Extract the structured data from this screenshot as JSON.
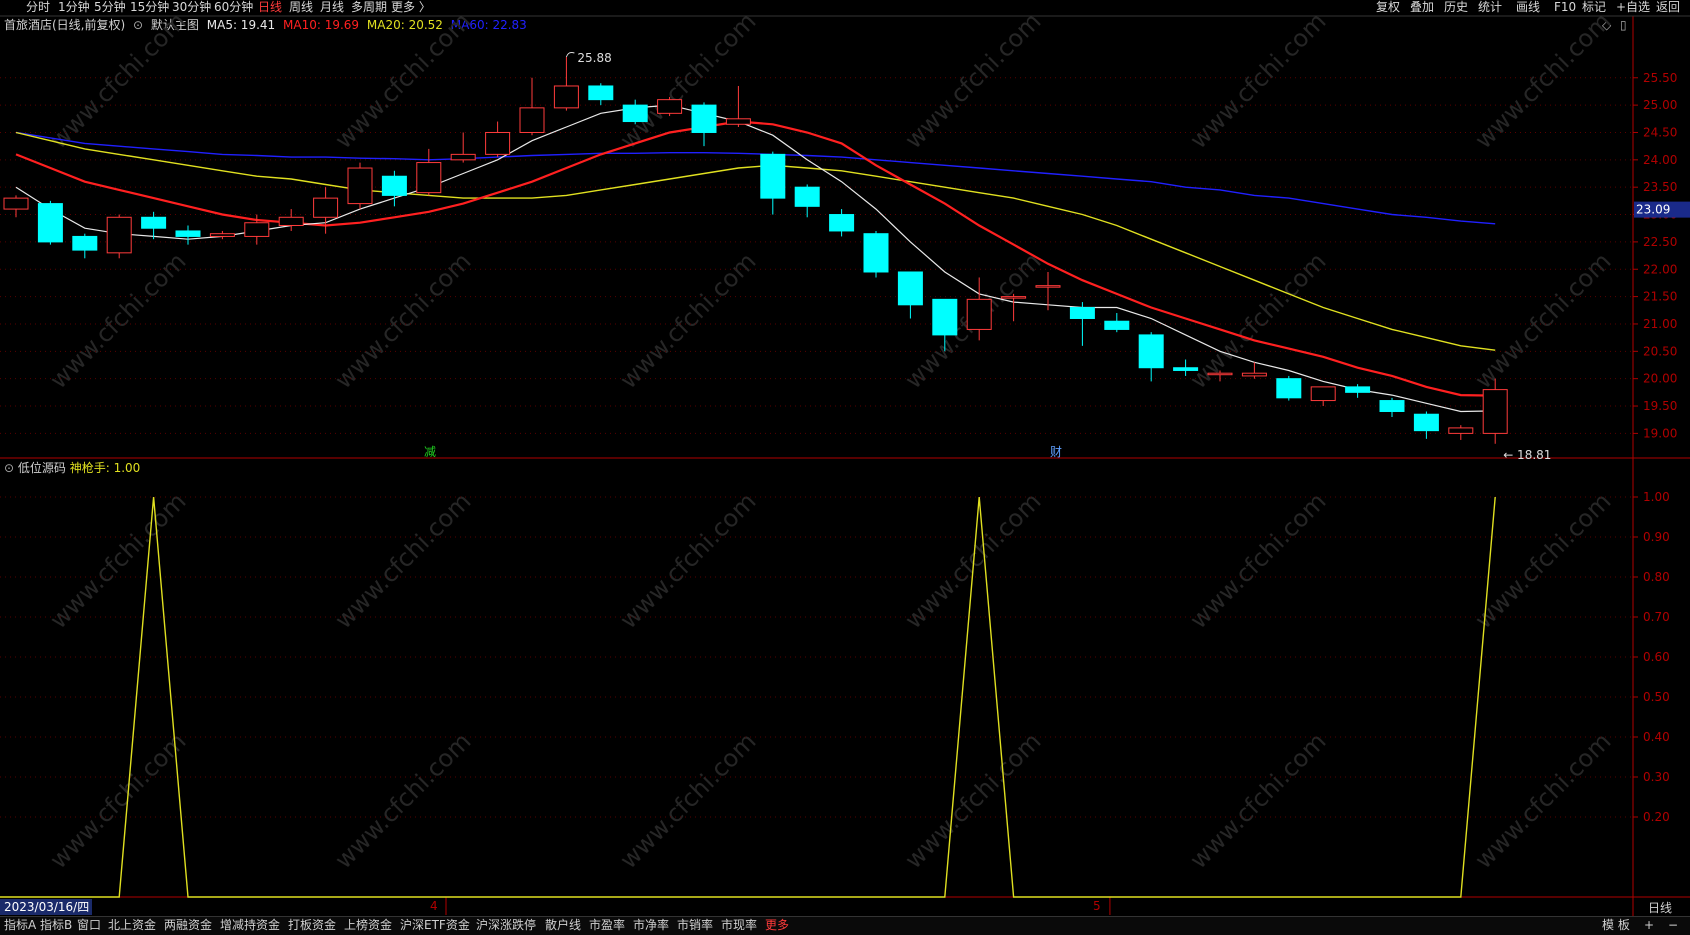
{
  "colors": {
    "up": "#ff3b3b",
    "down": "#00ffff",
    "ma5": "#e8e8e8",
    "ma10": "#ff2020",
    "ma20": "#e0e020",
    "ma60": "#2020ff",
    "indicator": "#e0e020",
    "axis": "#b00000",
    "grid": "#5a0000"
  },
  "topbar": {
    "periods": [
      "分时",
      "1分钟",
      "5分钟",
      "15分钟",
      "30分钟",
      "60分钟",
      "日线",
      "周线",
      "月线",
      "多周期",
      "更多 〉"
    ],
    "active_period": "日线",
    "right_buttons": [
      "复权",
      "叠加",
      "历史",
      "统计",
      "画线",
      "F10",
      "+自选",
      "返回"
    ],
    "mark_label": "标记"
  },
  "main_chart": {
    "stock_name": "首旅酒店(日线,前复权)",
    "main_chart_label": "默认主图",
    "ma5_label": "MA5: 19.41",
    "ma10_label": "MA10: 19.69",
    "ma20_label": "MA20: 20.52",
    "ma60_label": "MA60: 22.83",
    "high_label": "25.88",
    "low_label": "18.81",
    "current_price": "23.09",
    "marker_jian": "减",
    "marker_cai": "财",
    "y_ticks": [
      "25.50",
      "25.00",
      "24.50",
      "24.00",
      "23.50",
      "23.00",
      "22.50",
      "22.00",
      "21.50",
      "21.00",
      "20.50",
      "20.00",
      "19.50",
      "19.00"
    ]
  },
  "chart_data": [
    {
      "type": "candlestick",
      "title": "首旅酒店(日线,前复权)",
      "ylim": [
        18.55,
        26.3
      ],
      "candles": [
        {
          "o": 23.1,
          "h": 23.35,
          "l": 22.95,
          "c": 23.3
        },
        {
          "o": 23.2,
          "h": 23.25,
          "l": 22.45,
          "c": 22.5
        },
        {
          "o": 22.6,
          "h": 22.65,
          "l": 22.2,
          "c": 22.35
        },
        {
          "o": 22.3,
          "h": 23.0,
          "l": 22.2,
          "c": 22.95
        },
        {
          "o": 22.95,
          "h": 23.05,
          "l": 22.55,
          "c": 22.75
        },
        {
          "o": 22.7,
          "h": 22.8,
          "l": 22.45,
          "c": 22.6
        },
        {
          "o": 22.6,
          "h": 22.7,
          "l": 22.55,
          "c": 22.65
        },
        {
          "o": 22.6,
          "h": 23.0,
          "l": 22.45,
          "c": 22.85
        },
        {
          "o": 22.8,
          "h": 23.1,
          "l": 22.7,
          "c": 22.95
        },
        {
          "o": 22.95,
          "h": 23.5,
          "l": 22.65,
          "c": 23.3
        },
        {
          "o": 23.2,
          "h": 23.95,
          "l": 23.1,
          "c": 23.85
        },
        {
          "o": 23.7,
          "h": 23.8,
          "l": 23.15,
          "c": 23.35
        },
        {
          "o": 23.4,
          "h": 24.2,
          "l": 23.35,
          "c": 23.95
        },
        {
          "o": 24.0,
          "h": 24.5,
          "l": 23.95,
          "c": 24.1
        },
        {
          "o": 24.1,
          "h": 24.7,
          "l": 24.05,
          "c": 24.5
        },
        {
          "o": 24.5,
          "h": 25.5,
          "l": 24.45,
          "c": 24.95
        },
        {
          "o": 24.95,
          "h": 25.88,
          "l": 24.9,
          "c": 25.35
        },
        {
          "o": 25.35,
          "h": 25.4,
          "l": 25.0,
          "c": 25.1
        },
        {
          "o": 25.0,
          "h": 25.1,
          "l": 24.65,
          "c": 24.7
        },
        {
          "o": 24.85,
          "h": 25.15,
          "l": 24.8,
          "c": 25.1
        },
        {
          "o": 25.0,
          "h": 25.05,
          "l": 24.25,
          "c": 24.5
        },
        {
          "o": 24.65,
          "h": 25.35,
          "l": 24.6,
          "c": 24.75
        },
        {
          "o": 24.1,
          "h": 24.15,
          "l": 23.0,
          "c": 23.3
        },
        {
          "o": 23.5,
          "h": 23.55,
          "l": 22.95,
          "c": 23.15
        },
        {
          "o": 23.0,
          "h": 23.1,
          "l": 22.6,
          "c": 22.7
        },
        {
          "o": 22.65,
          "h": 22.7,
          "l": 21.85,
          "c": 21.95
        },
        {
          "o": 21.95,
          "h": 21.95,
          "l": 21.1,
          "c": 21.35
        },
        {
          "o": 21.45,
          "h": 21.45,
          "l": 20.5,
          "c": 20.8
        },
        {
          "o": 20.9,
          "h": 21.85,
          "l": 20.7,
          "c": 21.45
        },
        {
          "o": 21.5,
          "h": 21.55,
          "l": 21.05,
          "c": 21.5
        },
        {
          "o": 21.7,
          "h": 21.95,
          "l": 21.25,
          "c": 21.7
        },
        {
          "o": 21.3,
          "h": 21.4,
          "l": 20.6,
          "c": 21.1
        },
        {
          "o": 21.05,
          "h": 21.2,
          "l": 20.85,
          "c": 20.9
        },
        {
          "o": 20.8,
          "h": 20.85,
          "l": 19.95,
          "c": 20.2
        },
        {
          "o": 20.2,
          "h": 20.35,
          "l": 20.05,
          "c": 20.15
        },
        {
          "o": 20.1,
          "h": 20.15,
          "l": 19.95,
          "c": 20.1
        },
        {
          "o": 20.05,
          "h": 20.3,
          "l": 20.0,
          "c": 20.1
        },
        {
          "o": 20.0,
          "h": 20.05,
          "l": 19.6,
          "c": 19.65
        },
        {
          "o": 19.6,
          "h": 19.85,
          "l": 19.5,
          "c": 19.85
        },
        {
          "o": 19.85,
          "h": 19.9,
          "l": 19.65,
          "c": 19.75
        },
        {
          "o": 19.6,
          "h": 19.65,
          "l": 19.3,
          "c": 19.4
        },
        {
          "o": 19.35,
          "h": 19.4,
          "l": 18.9,
          "c": 19.05
        },
        {
          "o": 19.0,
          "h": 19.15,
          "l": 18.88,
          "c": 19.1
        },
        {
          "o": 19.0,
          "h": 20.0,
          "l": 18.81,
          "c": 19.8
        }
      ],
      "series": [
        {
          "name": "MA5",
          "values": [
            23.5,
            23.1,
            22.75,
            22.65,
            22.6,
            22.55,
            22.6,
            22.7,
            22.8,
            22.85,
            23.1,
            23.3,
            23.5,
            23.75,
            24.0,
            24.35,
            24.6,
            24.85,
            24.95,
            25.0,
            24.85,
            24.7,
            24.45,
            24.0,
            23.6,
            23.1,
            22.5,
            21.95,
            21.55,
            21.4,
            21.35,
            21.3,
            21.3,
            21.1,
            20.8,
            20.5,
            20.3,
            20.15,
            19.95,
            19.8,
            19.7,
            19.55,
            19.4,
            19.41
          ]
        },
        {
          "name": "MA10",
          "values": [
            24.1,
            23.85,
            23.6,
            23.45,
            23.3,
            23.15,
            23.0,
            22.9,
            22.85,
            22.8,
            22.85,
            22.95,
            23.05,
            23.2,
            23.4,
            23.6,
            23.85,
            24.1,
            24.3,
            24.5,
            24.6,
            24.7,
            24.65,
            24.5,
            24.3,
            23.9,
            23.55,
            23.2,
            22.8,
            22.45,
            22.1,
            21.8,
            21.55,
            21.3,
            21.1,
            20.9,
            20.7,
            20.55,
            20.4,
            20.2,
            20.05,
            19.85,
            19.7,
            19.69
          ]
        },
        {
          "name": "MA20",
          "values": [
            24.5,
            24.35,
            24.2,
            24.1,
            24.0,
            23.9,
            23.8,
            23.7,
            23.65,
            23.55,
            23.45,
            23.4,
            23.35,
            23.3,
            23.3,
            23.3,
            23.35,
            23.45,
            23.55,
            23.65,
            23.75,
            23.85,
            23.9,
            23.85,
            23.8,
            23.7,
            23.6,
            23.5,
            23.4,
            23.3,
            23.15,
            23.0,
            22.8,
            22.55,
            22.3,
            22.05,
            21.8,
            21.55,
            21.3,
            21.1,
            20.9,
            20.75,
            20.6,
            20.52
          ]
        },
        {
          "name": "MA60",
          "values": [
            24.5,
            24.4,
            24.3,
            24.25,
            24.2,
            24.15,
            24.1,
            24.08,
            24.05,
            24.05,
            24.03,
            24.02,
            24.0,
            24.02,
            24.05,
            24.08,
            24.1,
            24.12,
            24.12,
            24.13,
            24.13,
            24.12,
            24.1,
            24.08,
            24.05,
            24.0,
            23.95,
            23.9,
            23.85,
            23.8,
            23.75,
            23.7,
            23.65,
            23.6,
            23.5,
            23.45,
            23.35,
            23.3,
            23.2,
            23.1,
            23.0,
            22.95,
            22.88,
            22.83
          ]
        }
      ]
    },
    {
      "type": "line",
      "title": "低位源码",
      "ylim": [
        0.0,
        1.05
      ],
      "series": [
        {
          "name": "神枪手",
          "values": [
            0,
            0,
            0,
            0,
            1,
            0,
            0,
            0,
            0,
            0,
            0,
            0,
            0,
            0,
            0,
            0,
            0,
            0,
            0,
            0,
            0,
            0,
            0,
            0,
            0,
            0,
            0,
            0,
            1,
            0,
            0,
            0,
            0,
            0,
            0,
            0,
            0,
            0,
            0,
            0,
            0,
            0,
            0,
            1
          ]
        }
      ],
      "y_ticks": [
        "1.00",
        "0.90",
        "0.80",
        "0.70",
        "0.60",
        "0.50",
        "0.40",
        "0.30",
        "0.20"
      ]
    }
  ],
  "indicator": {
    "name": "低位源码",
    "value_label": "神枪手: 1.00"
  },
  "x_axis": {
    "date": "2023/03/16/四",
    "month_4": "4",
    "month_5": "5",
    "period_label": "日线"
  },
  "bottombar": {
    "tabs": [
      "指标A",
      "指标B",
      "窗口",
      "北上资金",
      "两融资金",
      "增减持资金",
      "打板资金",
      "上榜资金",
      "沪深ETF资金",
      "沪深涨跌停",
      "散户线",
      "市盈率",
      "市净率",
      "市销率",
      "市现率",
      "更多"
    ],
    "right": [
      "模 板",
      "+",
      "−"
    ]
  },
  "watermark": "www.cfchi.com"
}
